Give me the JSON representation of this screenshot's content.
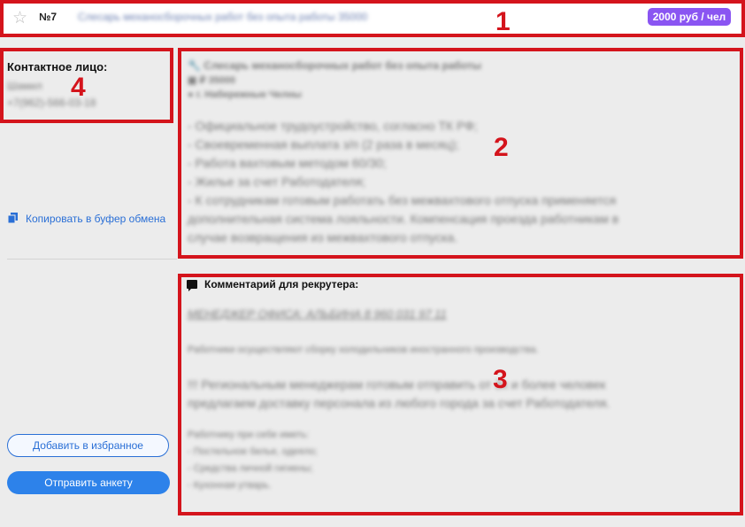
{
  "header": {
    "number": "№7",
    "title": "Слесарь механосборочных работ без опыта работы 35000",
    "price": "2000 руб / чел"
  },
  "contact": {
    "label": "Контактное лицо:",
    "name": "Шамил",
    "phone": "+7(962)-566-03-18"
  },
  "actions": {
    "copy_label": "Копировать в буфер обмена",
    "favorite_label": "Добавить в избранное",
    "send_label": "Отправить анкету"
  },
  "vacancy": {
    "title": "Слесарь механосборочных работ без опыта работы",
    "salary": "35000",
    "location": "г. Набережные Челны",
    "bullets": [
      "- Официальное трудоустройство, согласно ТК РФ;",
      "- Своевременная выплата з/п (2 раза в месяц);",
      "- Работа вахтовым методом 60/30;",
      "- Жилье за счет Работодателя;",
      "- К сотрудникам готовым работать без межвахтового отпуска применяется\nдополнительная система лояльности. Компенсация проезда работникам в\nслучае возвращения из межвахтового отпуска."
    ]
  },
  "comment": {
    "heading": "Комментарий для рекрутера:",
    "manager": "МЕНЕДЖЕР ОФИСА: АЛЬБИНА 8 960 031 97 11",
    "duties": "Работники осуществляют сборку холодильников иностранного производства.",
    "note": "!!! Региональным менеджерам готовым отправить от 3х и более человек\nпредлагаем доставку персонала из любого города за счет Работодателя.",
    "bring_title": "Работнику при себе иметь:",
    "bring_items": [
      "- Постельное белье, одеяло;",
      "- Средства личной гигиены;",
      "- Кухонная утварь."
    ]
  },
  "annotations": [
    "1",
    "2",
    "3",
    "4"
  ],
  "colors": {
    "annotation_red": "#d4141c",
    "badge_purple": "#8a55f2",
    "link_blue": "#2a6fd6",
    "button_blue": "#2d82ea"
  },
  "icons": [
    "star-icon",
    "copy-icon",
    "wrench-icon",
    "money-icon",
    "location-pin-icon",
    "comment-icon"
  ]
}
